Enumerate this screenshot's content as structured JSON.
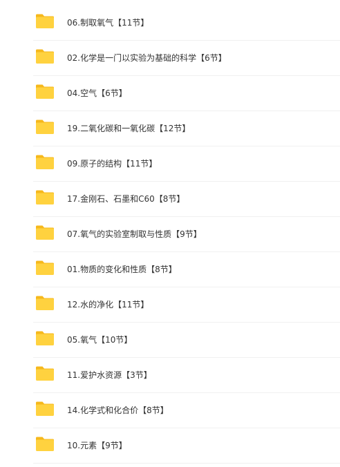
{
  "folder_icon": {
    "name": "folder-icon",
    "tab_color": "#F6B81C",
    "body_color": "#FFD23F"
  },
  "files": [
    {
      "name": "06.制取氧气【11节】"
    },
    {
      "name": "02.化学是一门以实验为基础的科学【6节】"
    },
    {
      "name": "04.空气【6节】"
    },
    {
      "name": "19.二氧化碳和一氧化碳【12节】"
    },
    {
      "name": "09.原子的结构【11节】"
    },
    {
      "name": "17.金刚石、石墨和C60【8节】"
    },
    {
      "name": "07.氧气的实验室制取与性质【9节】"
    },
    {
      "name": "01.物质的变化和性质【8节】"
    },
    {
      "name": "12.水的净化【11节】"
    },
    {
      "name": "05.氧气【10节】"
    },
    {
      "name": "11.爱护水资源【3节】"
    },
    {
      "name": "14.化学式和化合价【8节】"
    },
    {
      "name": "10.元素【9节】"
    }
  ]
}
